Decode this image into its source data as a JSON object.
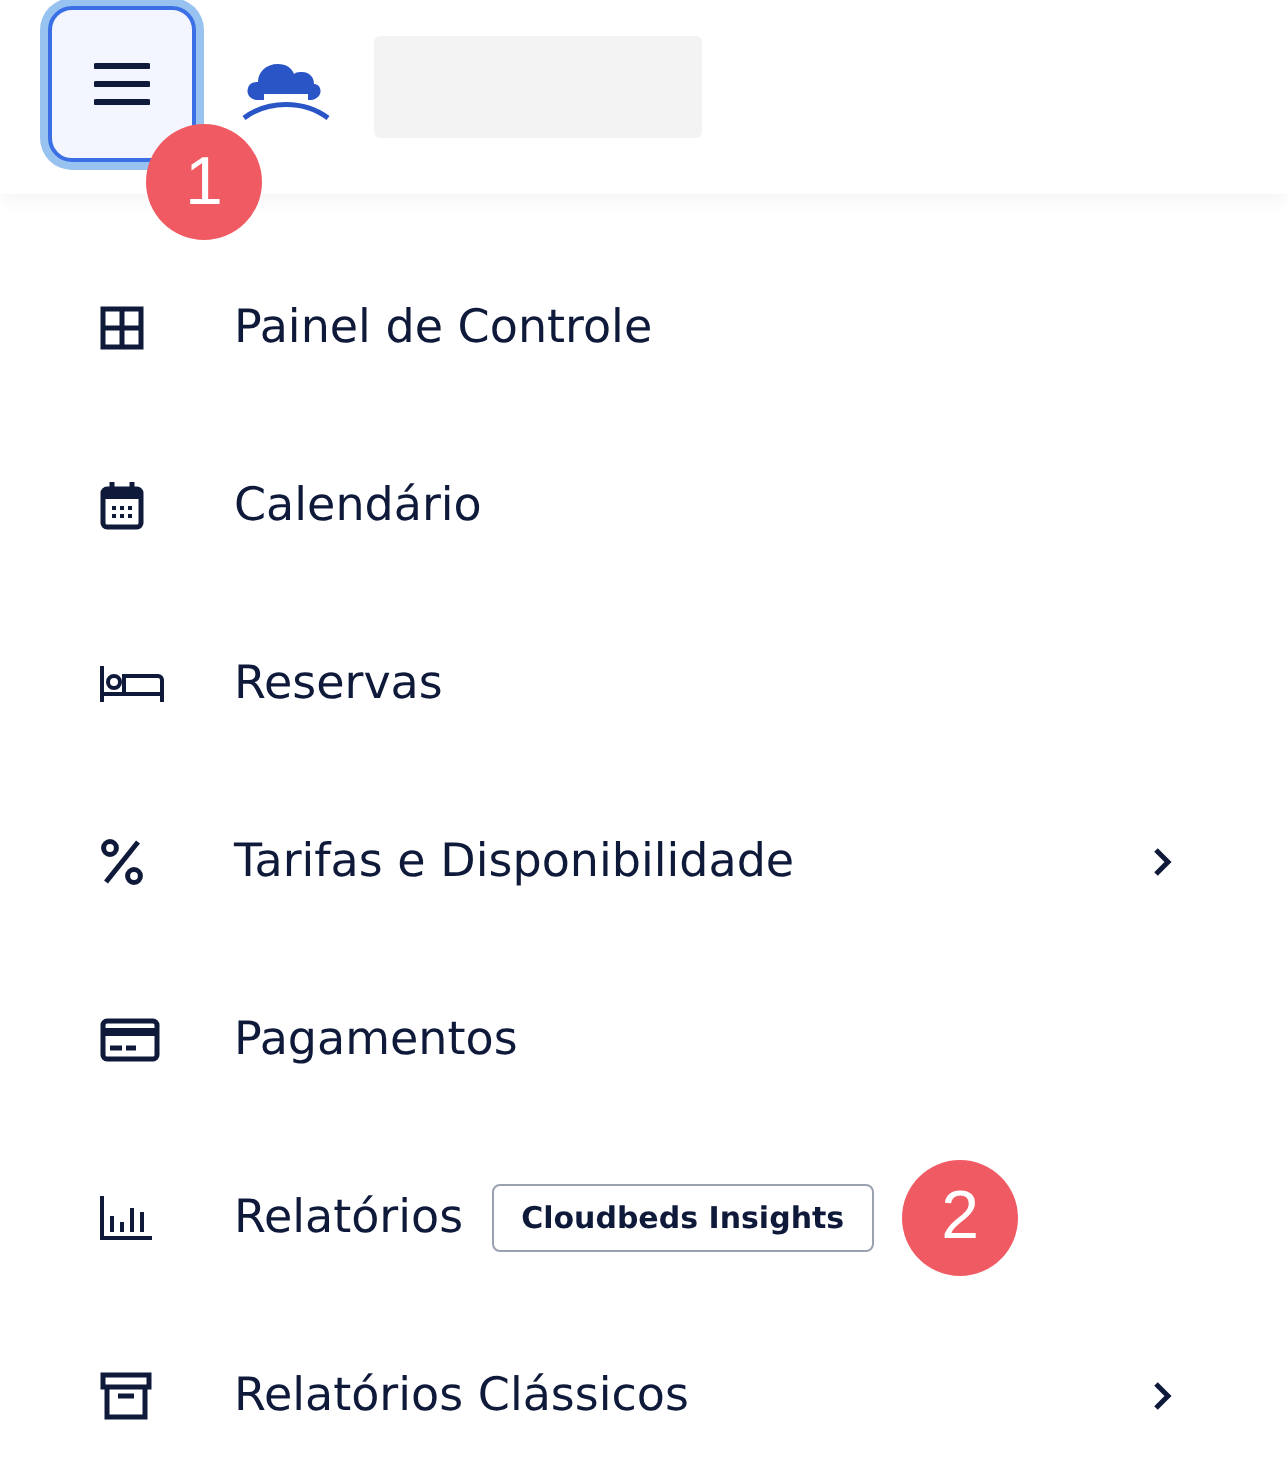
{
  "header": {
    "menu_button": {
      "focused": true
    },
    "callout": "1"
  },
  "menu": [
    {
      "label": "Painel de Controle",
      "has_submenu": false
    },
    {
      "label": "Calendário",
      "has_submenu": false
    },
    {
      "label": "Reservas",
      "has_submenu": false
    },
    {
      "label": "Tarifas e Disponibilidade",
      "has_submenu": true
    },
    {
      "label": "Pagamentos",
      "has_submenu": false
    },
    {
      "label": "Relatórios",
      "has_submenu": false,
      "tag": "Cloudbeds Insights",
      "callout": "2"
    },
    {
      "label": "Relatórios Clássicos",
      "has_submenu": true
    }
  ]
}
